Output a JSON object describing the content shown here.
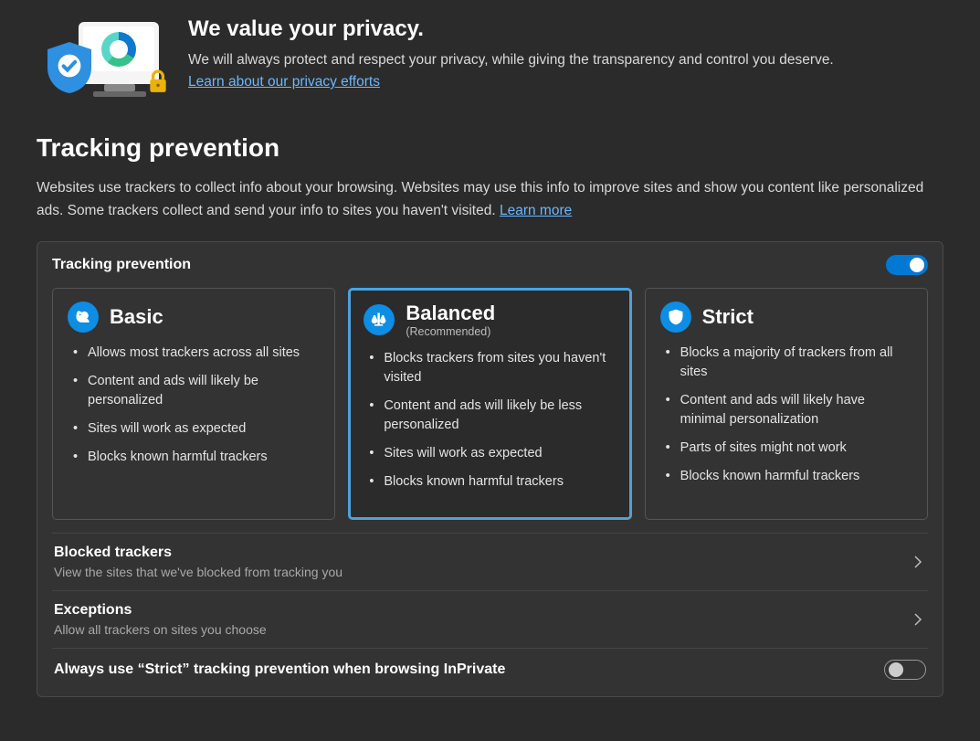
{
  "hero": {
    "title": "We value your privacy.",
    "body": "We will always protect and respect your privacy, while giving the transparency and control you deserve. ",
    "link": "Learn about our privacy efforts"
  },
  "section": {
    "title": "Tracking prevention",
    "desc_pre": "Websites use trackers to collect info about your browsing. Websites may use this info to improve sites and show you content like personalized ads. Some trackers collect and send your info to sites you haven't visited. ",
    "learn_more": "Learn more"
  },
  "panel": {
    "label": "Tracking prevention",
    "toggle_on": true,
    "cards": [
      {
        "title": "Basic",
        "sub": "",
        "bullets": [
          "Allows most trackers across all sites",
          "Content and ads will likely be personalized",
          "Sites will work as expected",
          "Blocks known harmful trackers"
        ]
      },
      {
        "title": "Balanced",
        "sub": "(Recommended)",
        "bullets": [
          "Blocks trackers from sites you haven't visited",
          "Content and ads will likely be less personalized",
          "Sites will work as expected",
          "Blocks known harmful trackers"
        ]
      },
      {
        "title": "Strict",
        "sub": "",
        "bullets": [
          "Blocks a majority of trackers from all sites",
          "Content and ads will likely have minimal personalization",
          "Parts of sites might not work",
          "Blocks known harmful trackers"
        ]
      }
    ],
    "rows": {
      "blocked": {
        "title": "Blocked trackers",
        "desc": "View the sites that we've blocked from tracking you"
      },
      "exceptions": {
        "title": "Exceptions",
        "desc": "Allow all trackers on sites you choose"
      },
      "inprivate": {
        "title": "Always use “Strict” tracking prevention when browsing InPrivate"
      }
    }
  }
}
